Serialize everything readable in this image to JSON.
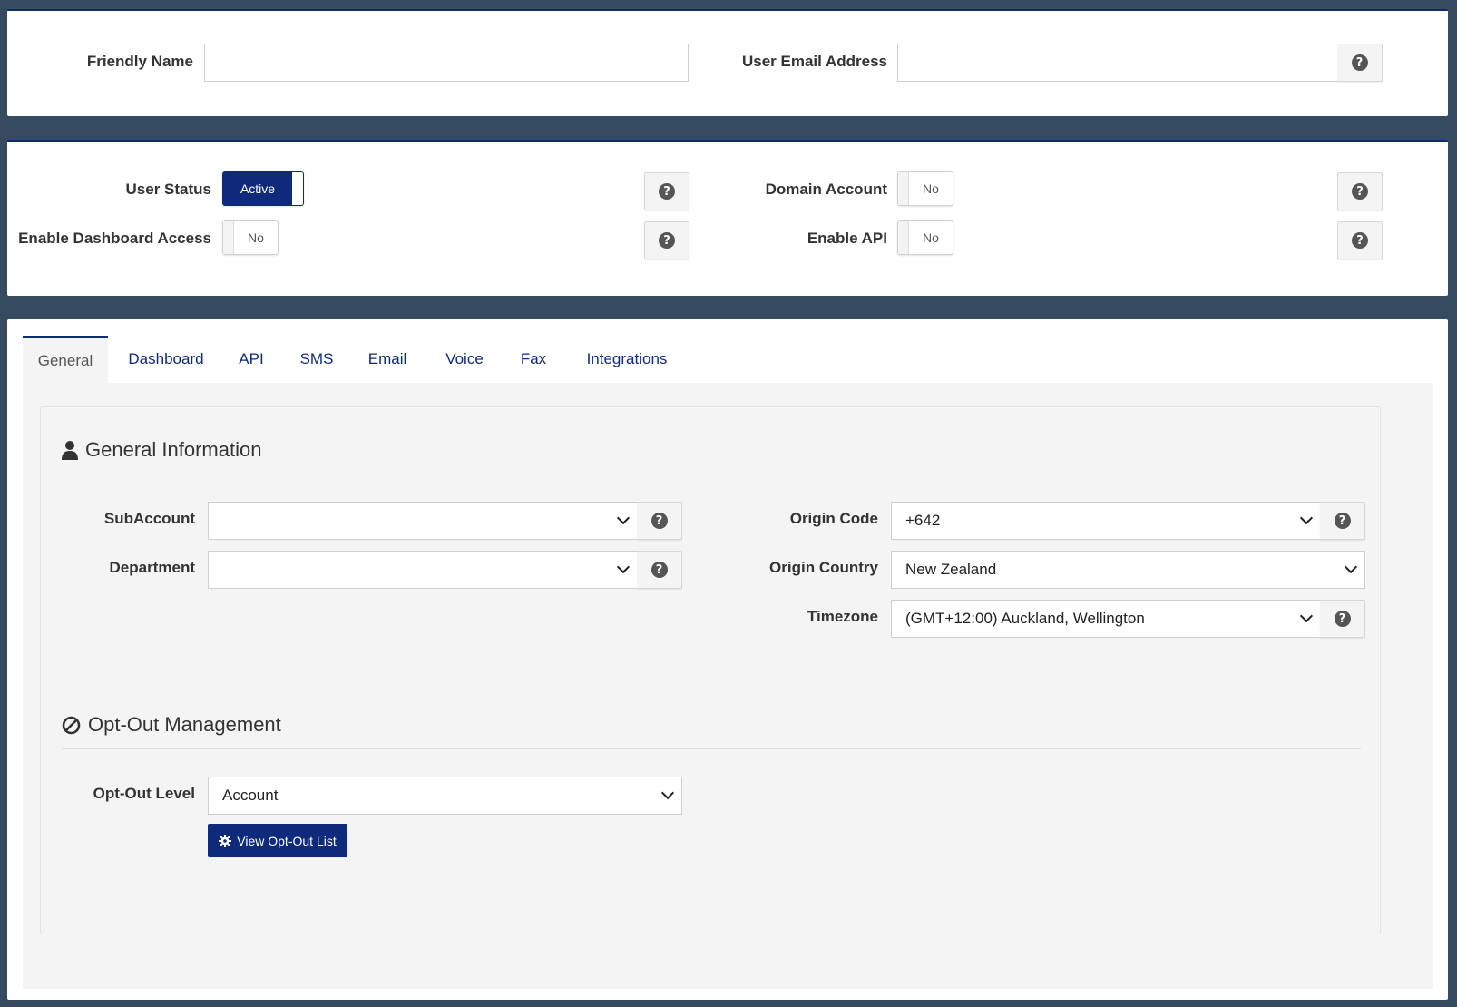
{
  "top": {
    "friendly_name_label": "Friendly Name",
    "friendly_name_value": "",
    "email_label": "User Email Address",
    "email_value": ""
  },
  "status": {
    "user_status_label": "User Status",
    "user_status_value": "Active",
    "dashboard_label": "Enable Dashboard Access",
    "dashboard_value": "No",
    "domain_label": "Domain Account",
    "domain_value": "No",
    "api_label": "Enable API",
    "api_value": "No"
  },
  "tabs": [
    {
      "label": "General",
      "active": true
    },
    {
      "label": "Dashboard"
    },
    {
      "label": "API"
    },
    {
      "label": "SMS"
    },
    {
      "label": "Email"
    },
    {
      "label": "Voice"
    },
    {
      "label": "Fax"
    },
    {
      "label": "Integrations"
    }
  ],
  "general": {
    "title": "General Information",
    "subaccount_label": "SubAccount",
    "subaccount_value": "",
    "department_label": "Department",
    "department_value": "",
    "origin_code_label": "Origin Code",
    "origin_code_value": "+642",
    "origin_country_label": "Origin Country",
    "origin_country_value": "New Zealand",
    "timezone_label": "Timezone",
    "timezone_value": "(GMT+12:00) Auckland, Wellington"
  },
  "optout": {
    "title": "Opt-Out Management",
    "level_label": "Opt-Out Level",
    "level_value": "Account",
    "view_button": "View Opt-Out List"
  },
  "icons": {
    "help": "question-circle-icon",
    "user": "user-icon",
    "ban": "ban-icon",
    "gear": "gear-icon"
  },
  "colors": {
    "primary": "#0f2a7a",
    "background": "#364a60"
  }
}
